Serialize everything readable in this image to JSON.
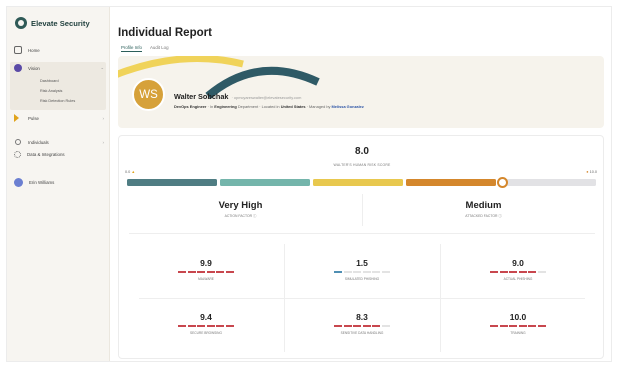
{
  "sidebar": {
    "brand": "Elevate Security",
    "items": [
      {
        "label": "Home",
        "icon": "home-icon"
      },
      {
        "label": "Vision",
        "icon": "vision-icon"
      },
      {
        "label": "Pulse",
        "icon": "pulse-icon"
      },
      {
        "label": "Individuals",
        "icon": "people-icon"
      },
      {
        "label": "Data & Integrations",
        "icon": "gear-icon"
      }
    ],
    "vision_subitems": [
      "Dashboard",
      "Risk Analysis",
      "Risk Detection Rules"
    ],
    "user": {
      "label": "Erin Williams",
      "icon": "user-avatar-icon"
    }
  },
  "page": {
    "title": "Individual Report",
    "tabs": [
      "Profile Info",
      "Audit Log"
    ]
  },
  "profile": {
    "initials": "WS",
    "name": "Walter Sobchak",
    "email": "opmcyareswalter@elevatesecurity.com",
    "role": "DevOps Engineer",
    "department_prefix": "In",
    "department": "Engineering",
    "department_suffix": "Department",
    "location_prefix": "Located in",
    "location": "United States",
    "manager_prefix": "Managed by",
    "manager": "Melissa Gonzalez"
  },
  "risk": {
    "score": "8.0",
    "score_label": "WALTER'S HUMAN RISK SCORE",
    "scale_min": "0.0",
    "scale_max": "10.0",
    "score_fraction": 0.8,
    "segment_colors": [
      "#4f7d83",
      "#74b5ab",
      "#e8c84e",
      "#d4872c",
      "#e2e2e5"
    ],
    "action_factor": {
      "value": "Very High",
      "label": "ACTION FACTOR"
    },
    "attacked_factor": {
      "value": "Medium",
      "label": "ATTACKED FACTOR"
    },
    "metrics": [
      {
        "value": "9.9",
        "label": "MALWARE",
        "fill": 0.99,
        "color": "#c8474e"
      },
      {
        "value": "1.5",
        "label": "SIMULATED PHISHING",
        "fill": 0.15,
        "color": "#4f8fb3"
      },
      {
        "value": "9.0",
        "label": "ACTUAL PHISHING",
        "fill": 0.9,
        "color": "#c8474e"
      },
      {
        "value": "9.4",
        "label": "SECURE BROWSING",
        "fill": 0.94,
        "color": "#c8474e"
      },
      {
        "value": "8.3",
        "label": "SENSITIVE DATA HANDLING",
        "fill": 0.83,
        "color": "#c8474e"
      },
      {
        "value": "10.0",
        "label": "TRAINING",
        "fill": 1.0,
        "color": "#c8474e"
      }
    ]
  }
}
